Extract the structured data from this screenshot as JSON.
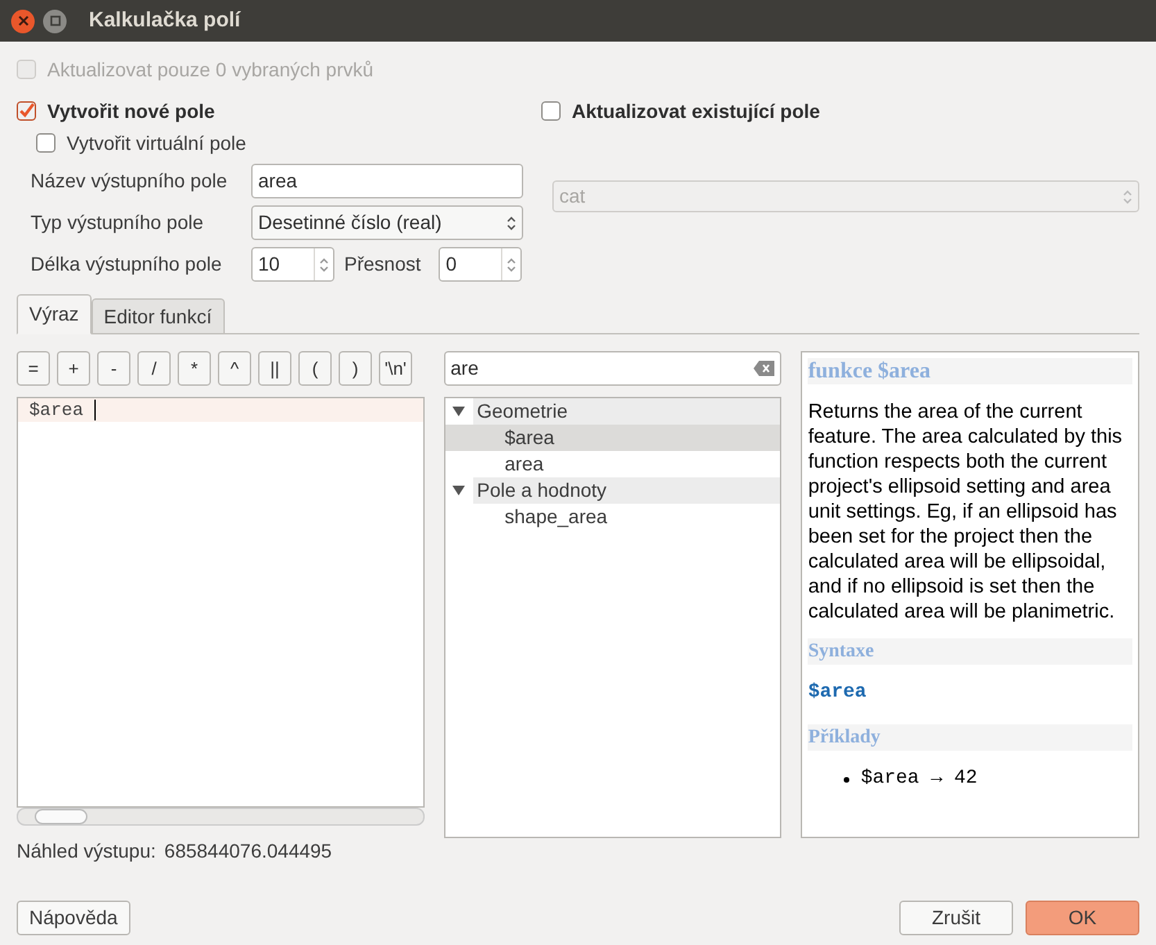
{
  "window": {
    "title": "Kalkulačka polí"
  },
  "options": {
    "update_selected": {
      "label": "Aktualizovat pouze 0 vybraných prvků",
      "checked": false,
      "disabled": true
    },
    "create_new": {
      "label": "Vytvořit nové pole",
      "checked": true
    },
    "virtual_field": {
      "label": "Vytvořit virtuální pole",
      "checked": false
    },
    "update_existing": {
      "label": "Aktualizovat existující pole",
      "checked": false
    }
  },
  "new_field": {
    "name_label": "Název výstupního pole",
    "name_value": "area",
    "type_label": "Typ výstupního pole",
    "type_value": "Desetinné číslo (real)",
    "length_label": "Délka výstupního pole",
    "length_value": "10",
    "precision_label": "Přesnost",
    "precision_value": "0"
  },
  "existing_field": {
    "value": "cat",
    "disabled": true
  },
  "tabs": [
    {
      "label": "Výraz",
      "selected": true
    },
    {
      "label": "Editor funkcí",
      "selected": false
    }
  ],
  "operators": [
    "=",
    "+",
    "-",
    "/",
    "*",
    "^",
    "||",
    "(",
    ")",
    "'\\n'"
  ],
  "expression": "$area",
  "search": {
    "value": "are"
  },
  "tree": [
    {
      "label": "Geometrie",
      "expanded": true,
      "children": [
        {
          "label": "$area",
          "selected": true
        },
        {
          "label": "area",
          "selected": false
        }
      ]
    },
    {
      "label": "Pole a hodnoty",
      "expanded": true,
      "children": [
        {
          "label": "shape_area",
          "selected": false
        }
      ]
    }
  ],
  "help": {
    "title": "funkce $area",
    "description": "Returns the area of the current feature. The area calculated by this function respects both the current project's ellipsoid setting and area unit settings. Eg, if an ellipsoid has been set for the project then the calculated area will be ellipsoidal, and if no ellipsoid is set then the calculated area will be planimetric.",
    "syntax_heading": "Syntaxe",
    "syntax": "$area",
    "examples_heading": "Příklady",
    "examples": [
      "$area → 42"
    ]
  },
  "preview": {
    "label": "Náhled výstupu:",
    "value": "685844076.044495"
  },
  "buttons": [
    {
      "label": "Nápověda",
      "kind": "default"
    },
    {
      "label": "Zrušit",
      "kind": "default"
    },
    {
      "label": "OK",
      "kind": "primary"
    }
  ]
}
